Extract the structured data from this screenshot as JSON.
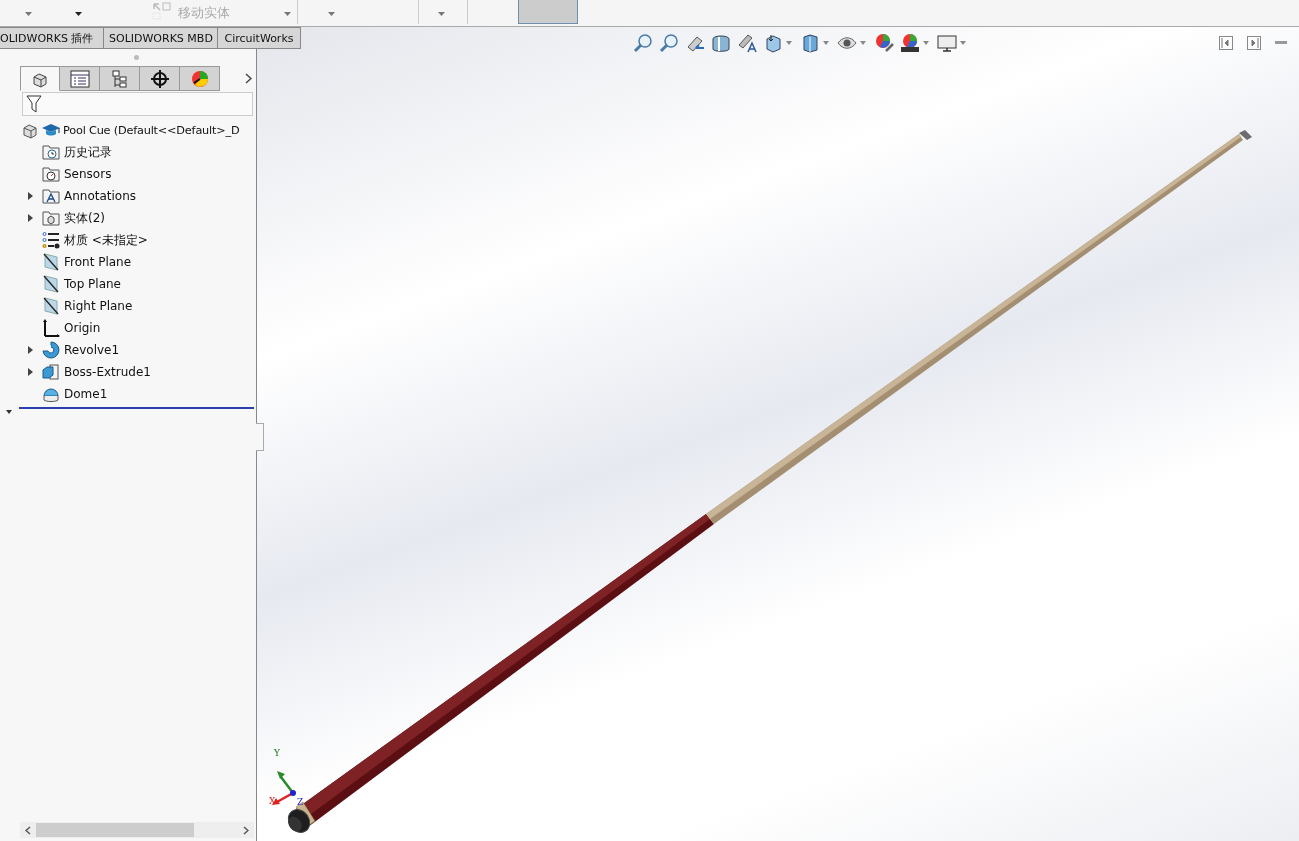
{
  "toolbar": {
    "move_body": {
      "label": "移动实体",
      "disabled": true
    }
  },
  "ribbon_tabs": [
    {
      "label": "OLIDWORKS 插件",
      "selected": false
    },
    {
      "label": "SOLIDWORKS MBD",
      "selected": false
    },
    {
      "label": "CircuitWorks",
      "selected": false
    }
  ],
  "panel_tabs": [
    {
      "kind": "feature",
      "selected": true
    },
    {
      "kind": "property",
      "selected": false
    },
    {
      "kind": "config",
      "selected": false
    },
    {
      "kind": "dimxpert",
      "selected": false
    },
    {
      "kind": "display",
      "selected": false
    }
  ],
  "tree": {
    "label": "Pool Cue  (Default<<Default>_D",
    "children": [
      {
        "label": "历史记录",
        "kind": "history",
        "expandable": false
      },
      {
        "label": "Sensors",
        "kind": "sensors",
        "expandable": false
      },
      {
        "label": "Annotations",
        "kind": "annotations",
        "expandable": true
      },
      {
        "label": "实体(2)",
        "kind": "bodies",
        "expandable": true
      },
      {
        "label": "材质 <未指定>",
        "kind": "material",
        "expandable": false
      },
      {
        "label": "Front Plane",
        "kind": "plane",
        "expandable": false
      },
      {
        "label": "Top Plane",
        "kind": "plane",
        "expandable": false
      },
      {
        "label": "Right Plane",
        "kind": "plane",
        "expandable": false
      },
      {
        "label": "Origin",
        "kind": "origin",
        "expandable": false
      },
      {
        "label": "Revolve1",
        "kind": "revolve",
        "expandable": true
      },
      {
        "label": "Boss-Extrude1",
        "kind": "extrude",
        "expandable": true
      },
      {
        "label": "Dome1",
        "kind": "dome",
        "expandable": false
      }
    ]
  },
  "triad": {
    "x": "X",
    "y": "Y",
    "z": "Z"
  }
}
